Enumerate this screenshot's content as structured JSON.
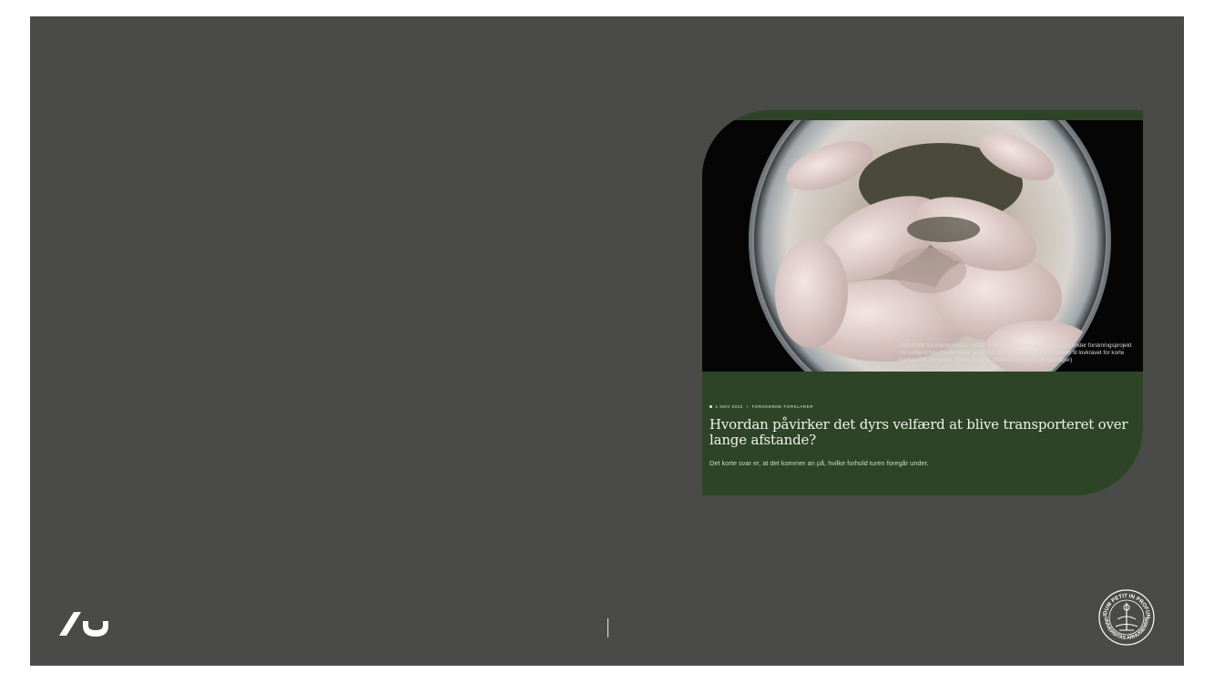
{
  "article": {
    "caption": "Stillbillede fra videokamera i loftet, som transporterer grise. Optaget under forskningsprojekt om velfærd hos fravænnede grise (20-25 kg). Grisenes plads svarer til lovkravet for korte transporter, og der er 70 cm til loftet. (Foto: Cecilie Kobek-Kjeldager)",
    "date": "1 NOV 2022",
    "separator": "\\",
    "category": "FORSKERNE FORKLARER",
    "headline": "Hvordan påvirker det dyrs velfærd at blive transporteret over lange afstande?",
    "lead": "Det korte svar er, at det kommer an på, hvilke forhold turen foregår under."
  },
  "seal": {
    "motto": "SOLIDUM PETIT IN PROFUNDIS",
    "name": "UNIVERSITAS ARHUSIENSIS"
  },
  "colors": {
    "slide_bg": "#4a4a49",
    "card_bg": "#2d4526",
    "text_light": "#f2f2ee"
  },
  "icons": {
    "logo": "au-logo",
    "seal": "university-seal-icon"
  }
}
